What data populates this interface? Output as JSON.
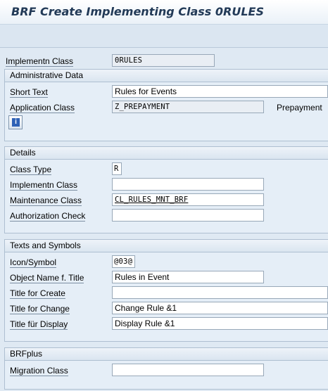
{
  "window": {
    "title": "BRF Create Implementing Class 0RULES"
  },
  "top": {
    "implementn_class_label": "Implementn Class",
    "implementn_class_value": "0RULES"
  },
  "admin": {
    "header": "Administrative Data",
    "short_text_label": "Short Text",
    "short_text_value": "Rules for Events",
    "app_class_label": "Application Class",
    "app_class_value": "Z_PREPAYMENT",
    "app_class_desc": "Prepayment",
    "info_icon": "info-icon"
  },
  "details": {
    "header": "Details",
    "class_type_label": "Class Type",
    "class_type_value": "R",
    "implementn_class_label": "Implementn Class",
    "implementn_class_value": "",
    "maintenance_class_label": "Maintenance Class",
    "maintenance_class_value": "CL_RULES_MNT_BRF",
    "auth_check_label": "Authorization Check",
    "auth_check_value": ""
  },
  "texts": {
    "header": "Texts and Symbols",
    "icon_symbol_label": "Icon/Symbol",
    "icon_symbol_value": "@03@",
    "object_name_label": "Object Name f. Title",
    "object_name_value": "Rules in Event",
    "title_create_label": "Title for Create",
    "title_create_value": "",
    "title_change_label": "Title for Change",
    "title_change_value": "Change Rule &1",
    "title_display_label": "Title für Display",
    "title_display_value": "Display Rule &1"
  },
  "brfplus": {
    "header": "BRFplus",
    "migration_class_label": "Migration Class",
    "migration_class_value": ""
  },
  "colors": {
    "title": "#223a57",
    "background": "#dfe9f3",
    "group_border": "#aebfd1"
  }
}
